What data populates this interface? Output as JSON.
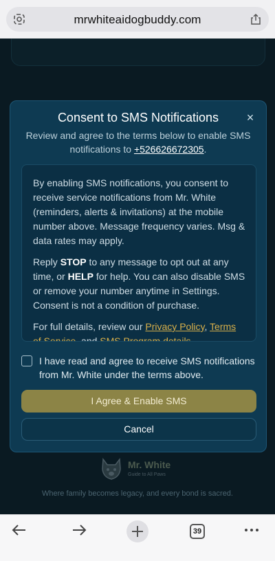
{
  "browser": {
    "url": "mrwhiteaidogbuddy.com",
    "tab_count": "39"
  },
  "modal": {
    "title": "Consent to SMS Notifications",
    "close_symbol": "×",
    "subtitle_prefix": "Review and agree to the terms below to enable SMS notifications to",
    "phone": "+526626672305",
    "subtitle_suffix": ".",
    "terms": {
      "p1": "By enabling SMS notifications, you consent to receive service notifications from Mr. White (reminders, alerts & invitations) at the mobile number above. Message frequency varies. Msg & data rates may apply.",
      "p2_a": "Reply",
      "p2_stop": "STOP",
      "p2_b": "to any message to opt out at any time, or",
      "p2_help": "HELP",
      "p2_c": "for help. You can also disable SMS or remove your number anytime in Settings. Consent is not a condition of purchase.",
      "p3_a": "For full details, review our",
      "privacy_link": "Privacy Policy",
      "p3_comma": ",",
      "terms_link": "Terms of Service",
      "p3_and": ", and",
      "sms_program": "SMS Program details",
      "p3_end": "."
    },
    "checkbox_label": "I have read and agree to receive SMS notifications from Mr. White under the terms above.",
    "agree_button": "I Agree & Enable SMS",
    "cancel_button": "Cancel"
  },
  "footer": {
    "brand_name": "Mr. White",
    "brand_tagline": "Guide to All Paws",
    "tagline": "Where family becomes legacy, and every bond is sacred."
  },
  "colors": {
    "modal_bg": "#0e3a52",
    "accent_gold": "#d9b04a",
    "agree_button": "#8c8446"
  },
  "icons": [
    "camera-search-icon",
    "share-icon",
    "back-icon",
    "forward-icon",
    "new-tab-icon",
    "tabs-icon",
    "more-icon",
    "dog-logo-icon"
  ]
}
